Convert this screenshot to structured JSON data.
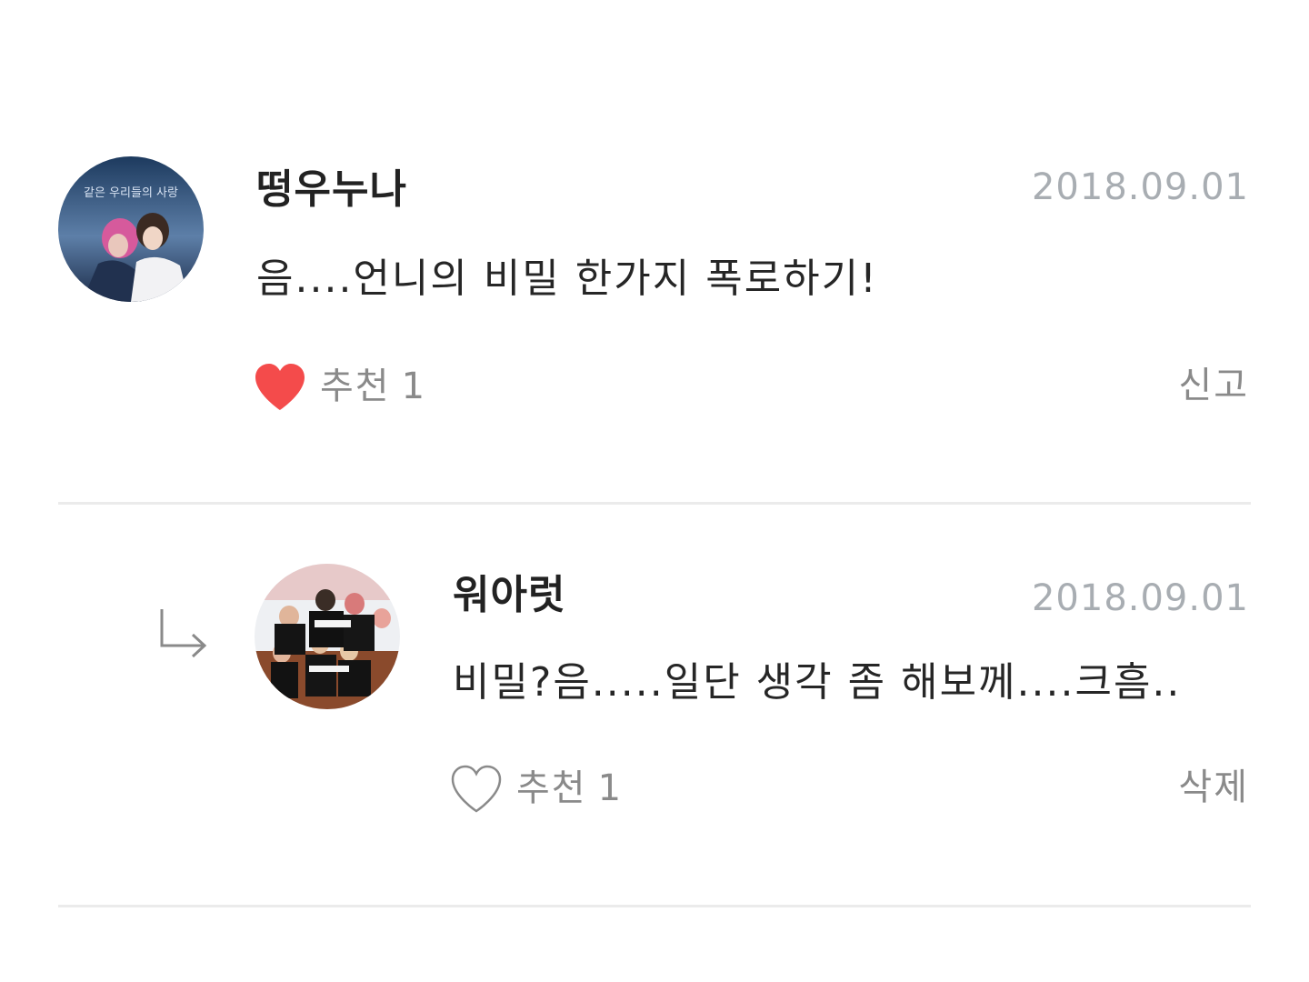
{
  "comments": [
    {
      "username": "떵우누나",
      "date": "2018.09.01",
      "body": "음....언니의 비밀 한가지 폭로하기!",
      "like_label": "추천",
      "like_count": "1",
      "liked": true,
      "action_label": "신고",
      "avatar_caption": "같은 우리들의 사랑"
    },
    {
      "username": "워아럿",
      "date": "2018.09.01",
      "body": "비밀?음.....일단 생각 좀 해보께....크흠..",
      "like_label": "추천",
      "like_count": "1",
      "liked": false,
      "action_label": "삭제",
      "is_reply": true
    }
  ],
  "colors": {
    "heart_filled": "#f44b4b",
    "heart_outline": "#8a8a8a",
    "date": "#a8adb2",
    "divider": "#ebebeb"
  },
  "icons": {
    "liked": "heart-filled-icon",
    "not_liked": "heart-outline-icon",
    "reply": "reply-arrow-icon"
  }
}
